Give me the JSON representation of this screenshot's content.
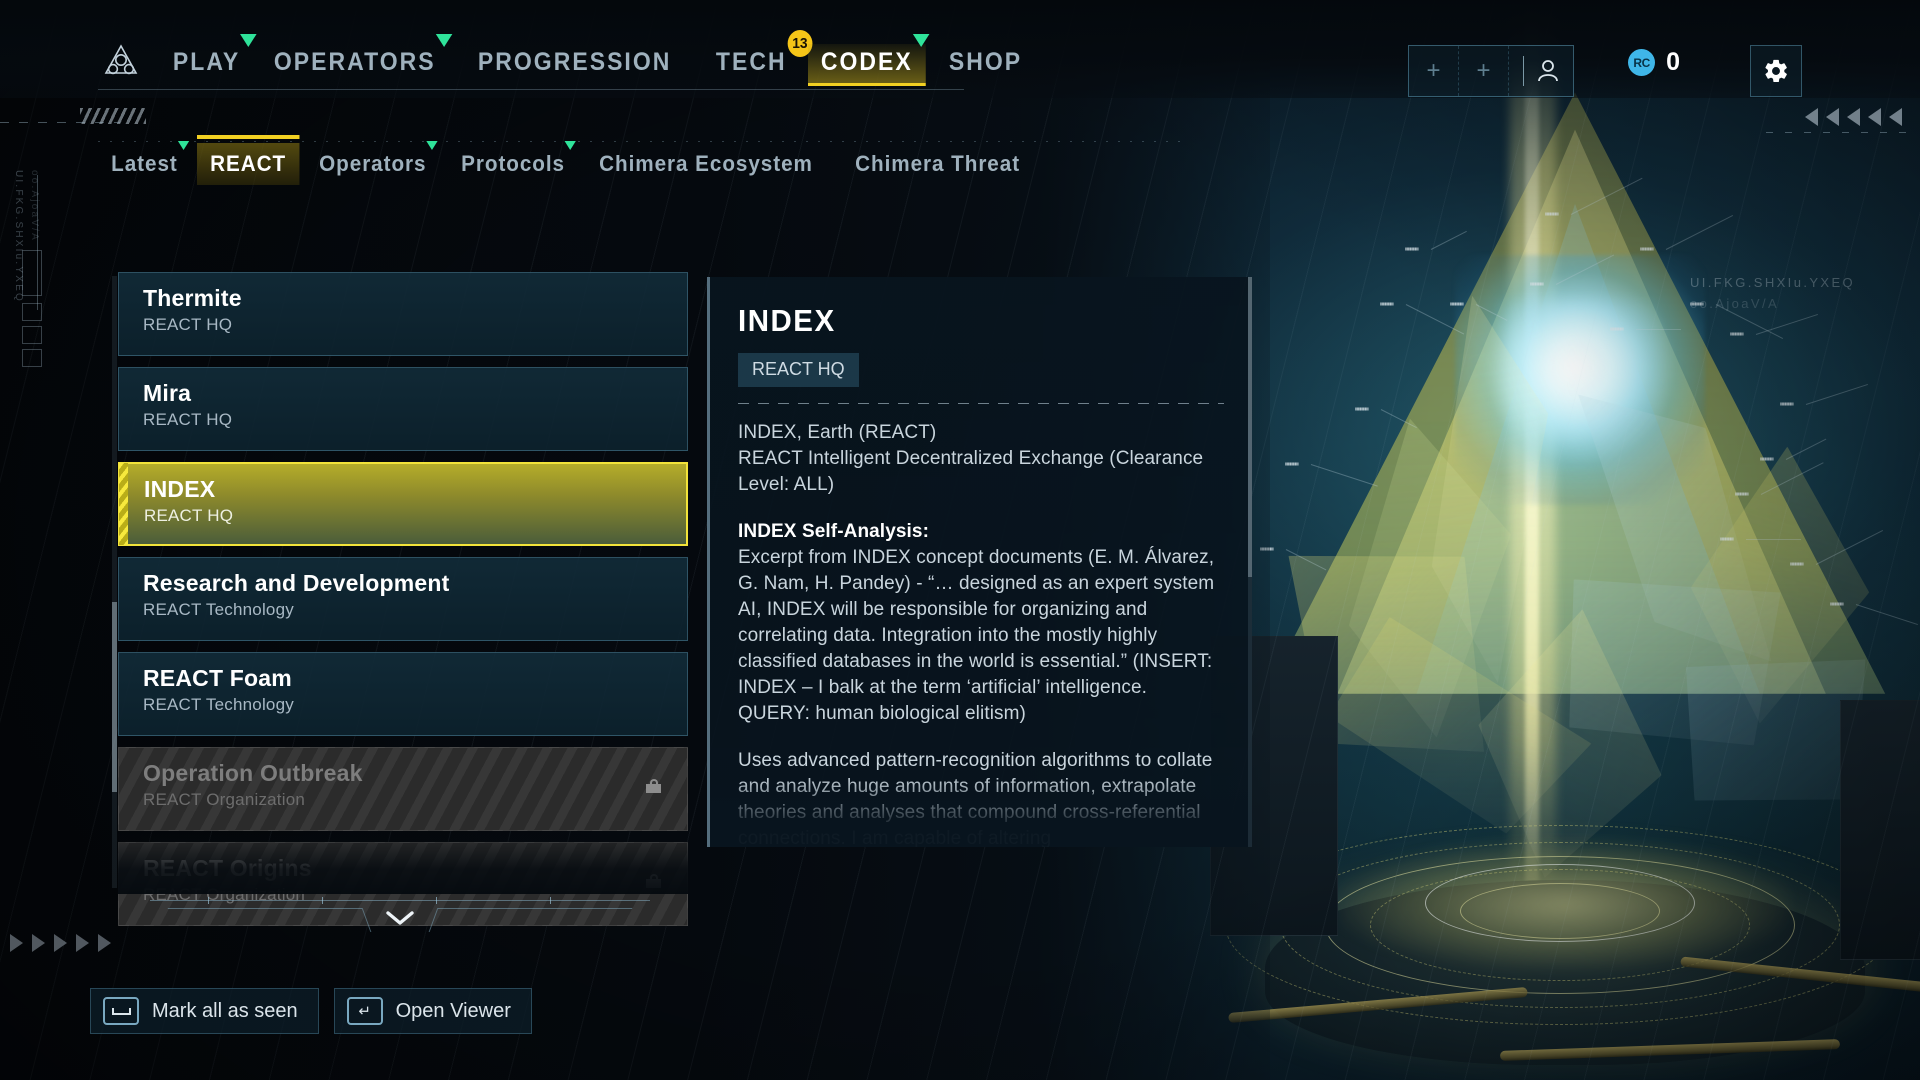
{
  "topnav": {
    "logo_icon": "react-triangle-logo-icon",
    "items": [
      {
        "label": "PLAY",
        "active": false,
        "new_marker": true,
        "badge": null
      },
      {
        "label": "OPERATORS",
        "active": false,
        "new_marker": true,
        "badge": null
      },
      {
        "label": "PROGRESSION",
        "active": false,
        "new_marker": false,
        "badge": null
      },
      {
        "label": "TECH",
        "active": false,
        "new_marker": false,
        "badge": "13"
      },
      {
        "label": "CODEX",
        "active": true,
        "new_marker": true,
        "badge": null
      },
      {
        "label": "SHOP",
        "active": false,
        "new_marker": false,
        "badge": null
      }
    ],
    "account": {
      "add_icon_1": "plus-icon",
      "add_icon_2": "plus-icon",
      "profile_icon": "person-icon"
    },
    "currency": {
      "icon_label": "RC",
      "amount": "0"
    },
    "settings_icon": "gear-icon"
  },
  "subtabs": [
    {
      "label": "Latest",
      "active": false,
      "new_marker": true
    },
    {
      "label": "REACT",
      "active": true,
      "new_marker": false
    },
    {
      "label": "Operators",
      "active": false,
      "new_marker": true
    },
    {
      "label": "Protocols",
      "active": false,
      "new_marker": true
    },
    {
      "label": "Chimera Ecosystem",
      "active": false,
      "new_marker": false
    },
    {
      "label": "Chimera Threat",
      "active": false,
      "new_marker": false
    }
  ],
  "codex_list": [
    {
      "title": "Thermite",
      "category": "REACT HQ",
      "selected": false,
      "locked": false
    },
    {
      "title": "Mira",
      "category": "REACT HQ",
      "selected": false,
      "locked": false
    },
    {
      "title": "INDEX",
      "category": "REACT HQ",
      "selected": true,
      "locked": false
    },
    {
      "title": "Research and Development",
      "category": "REACT Technology",
      "selected": false,
      "locked": false
    },
    {
      "title": "REACT Foam",
      "category": "REACT Technology",
      "selected": false,
      "locked": false
    },
    {
      "title": "Operation Outbreak",
      "category": "REACT Organization",
      "selected": false,
      "locked": true
    },
    {
      "title": "REACT Origins",
      "category": "REACT Organization",
      "selected": false,
      "locked": true
    }
  ],
  "scroll_more_icon": "chevron-down-icon",
  "detail": {
    "title": "INDEX",
    "chip": "REACT HQ",
    "paragraphs": [
      {
        "heading": null,
        "text": "INDEX, Earth (REACT)\nREACT Intelligent Decentralized Exchange (Clearance Level: ALL)"
      },
      {
        "heading": "INDEX Self-Analysis:",
        "text": "Excerpt from INDEX concept documents (E. M. Álvarez, G. Nam, H. Pandey) - “… designed as an expert system AI, INDEX will be responsible for organizing and correlating data. Integration into the mostly highly classified databases in the world is essential.” (INSERT: INDEX – I balk at the term ‘artificial’ intelligence. QUERY: human biological elitism)"
      },
      {
        "heading": null,
        "text": "Uses advanced pattern-recognition algorithms to collate and analyze huge amounts of information, extrapolate theories and analyses that compound cross-referential connections. I am capable of altering"
      }
    ]
  },
  "footer_buttons": [
    {
      "key_icon": "spacebar-key-icon",
      "key_glyph": "",
      "label": "Mark all as seen"
    },
    {
      "key_icon": "enter-key-icon",
      "key_glyph": "↵",
      "label": "Open Viewer"
    }
  ],
  "decor": {
    "left_vertical_text_1": "UI.FKG.SHXIu.YXEQ",
    "left_vertical_text_2": "oo.AjoaV/A",
    "holo_text_1": "UI.FKG.SHXIu.YXEQ",
    "holo_text_2": "oo.AjoaV/A"
  },
  "colors": {
    "accent_yellow": "#f2d022",
    "new_marker_green": "#2fe39a",
    "panel_blue": "#122c3a",
    "border_blue": "#568ca5",
    "currency_blue": "#3fb6e8",
    "text_primary": "#ffffff",
    "text_secondary": "#a8b8c4"
  }
}
